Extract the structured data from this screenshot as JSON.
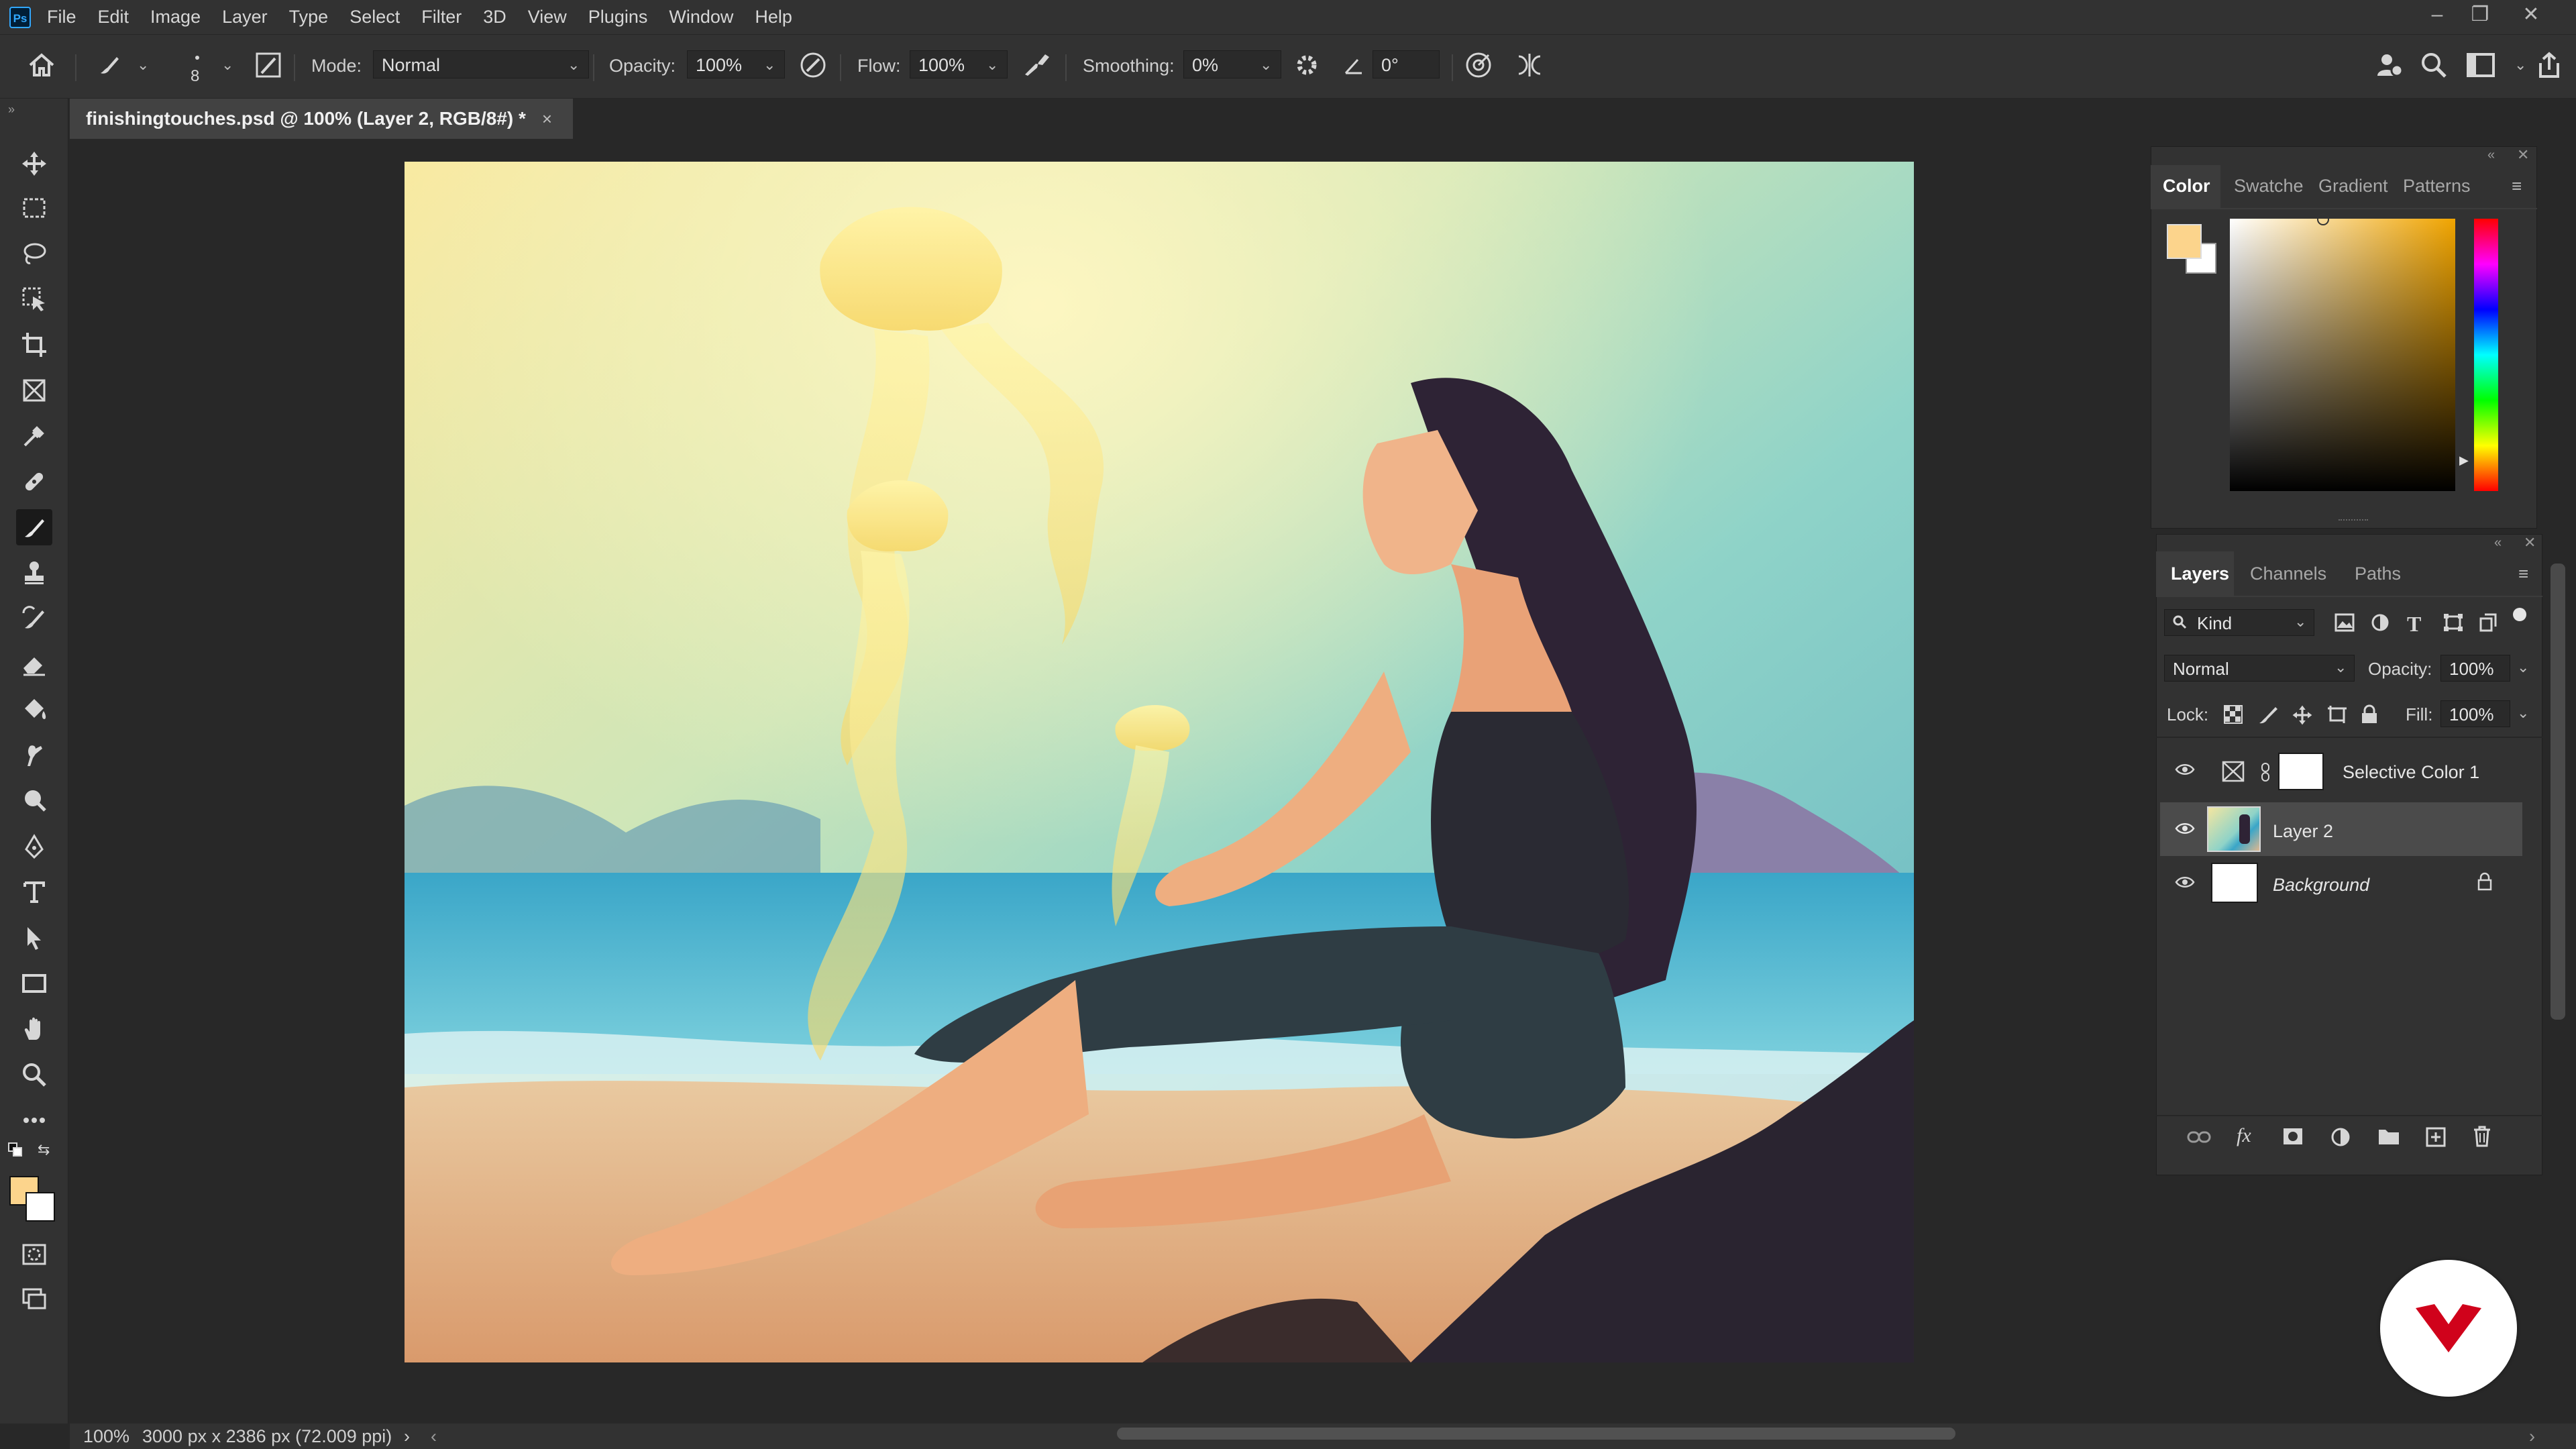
{
  "app": {
    "logo_text": "Ps",
    "menu": [
      "File",
      "Edit",
      "Image",
      "Layer",
      "Type",
      "Select",
      "Filter",
      "3D",
      "View",
      "Plugins",
      "Window",
      "Help"
    ],
    "window_controls": [
      "–",
      "❐",
      "✕"
    ]
  },
  "options_bar": {
    "brush_size": "8",
    "mode_label": "Mode:",
    "mode_value": "Normal",
    "opacity_label": "Opacity:",
    "opacity_value": "100%",
    "flow_label": "Flow:",
    "flow_value": "100%",
    "smoothing_label": "Smoothing:",
    "smoothing_value": "0%",
    "angle_value": "0°"
  },
  "document": {
    "tab_title": "finishingtouches.psd @ 100% (Layer 2, RGB/8#) *",
    "tab_close": "×"
  },
  "status": {
    "zoom": "100%",
    "doc_info": "3000 px x 2386 px (72.009 ppi)",
    "arrow": "›",
    "scroll_left": "‹",
    "scroll_right": "›"
  },
  "color_panel": {
    "tabs": [
      "Color",
      "Swatche",
      "Gradient",
      "Patterns"
    ],
    "active_tab": 0,
    "foreground": "#fcd48c",
    "background": "#ffffff"
  },
  "layers_panel": {
    "tabs": [
      "Layers",
      "Channels",
      "Paths"
    ],
    "filter_label": "Kind",
    "blend_mode": "Normal",
    "opacity_label": "Opacity:",
    "opacity_value": "100%",
    "lock_label": "Lock:",
    "fill_label": "Fill:",
    "fill_value": "100%",
    "layers": [
      {
        "name": "Selective Color 1",
        "type": "adjustment",
        "visible": true,
        "selected": false
      },
      {
        "name": "Layer 2",
        "type": "pixel",
        "visible": true,
        "selected": true
      },
      {
        "name": "Background",
        "type": "background",
        "visible": true,
        "selected": false,
        "locked": true
      }
    ]
  },
  "colors": {
    "accent_red": "#d0021b",
    "selected_row": "#4b4b4b"
  }
}
